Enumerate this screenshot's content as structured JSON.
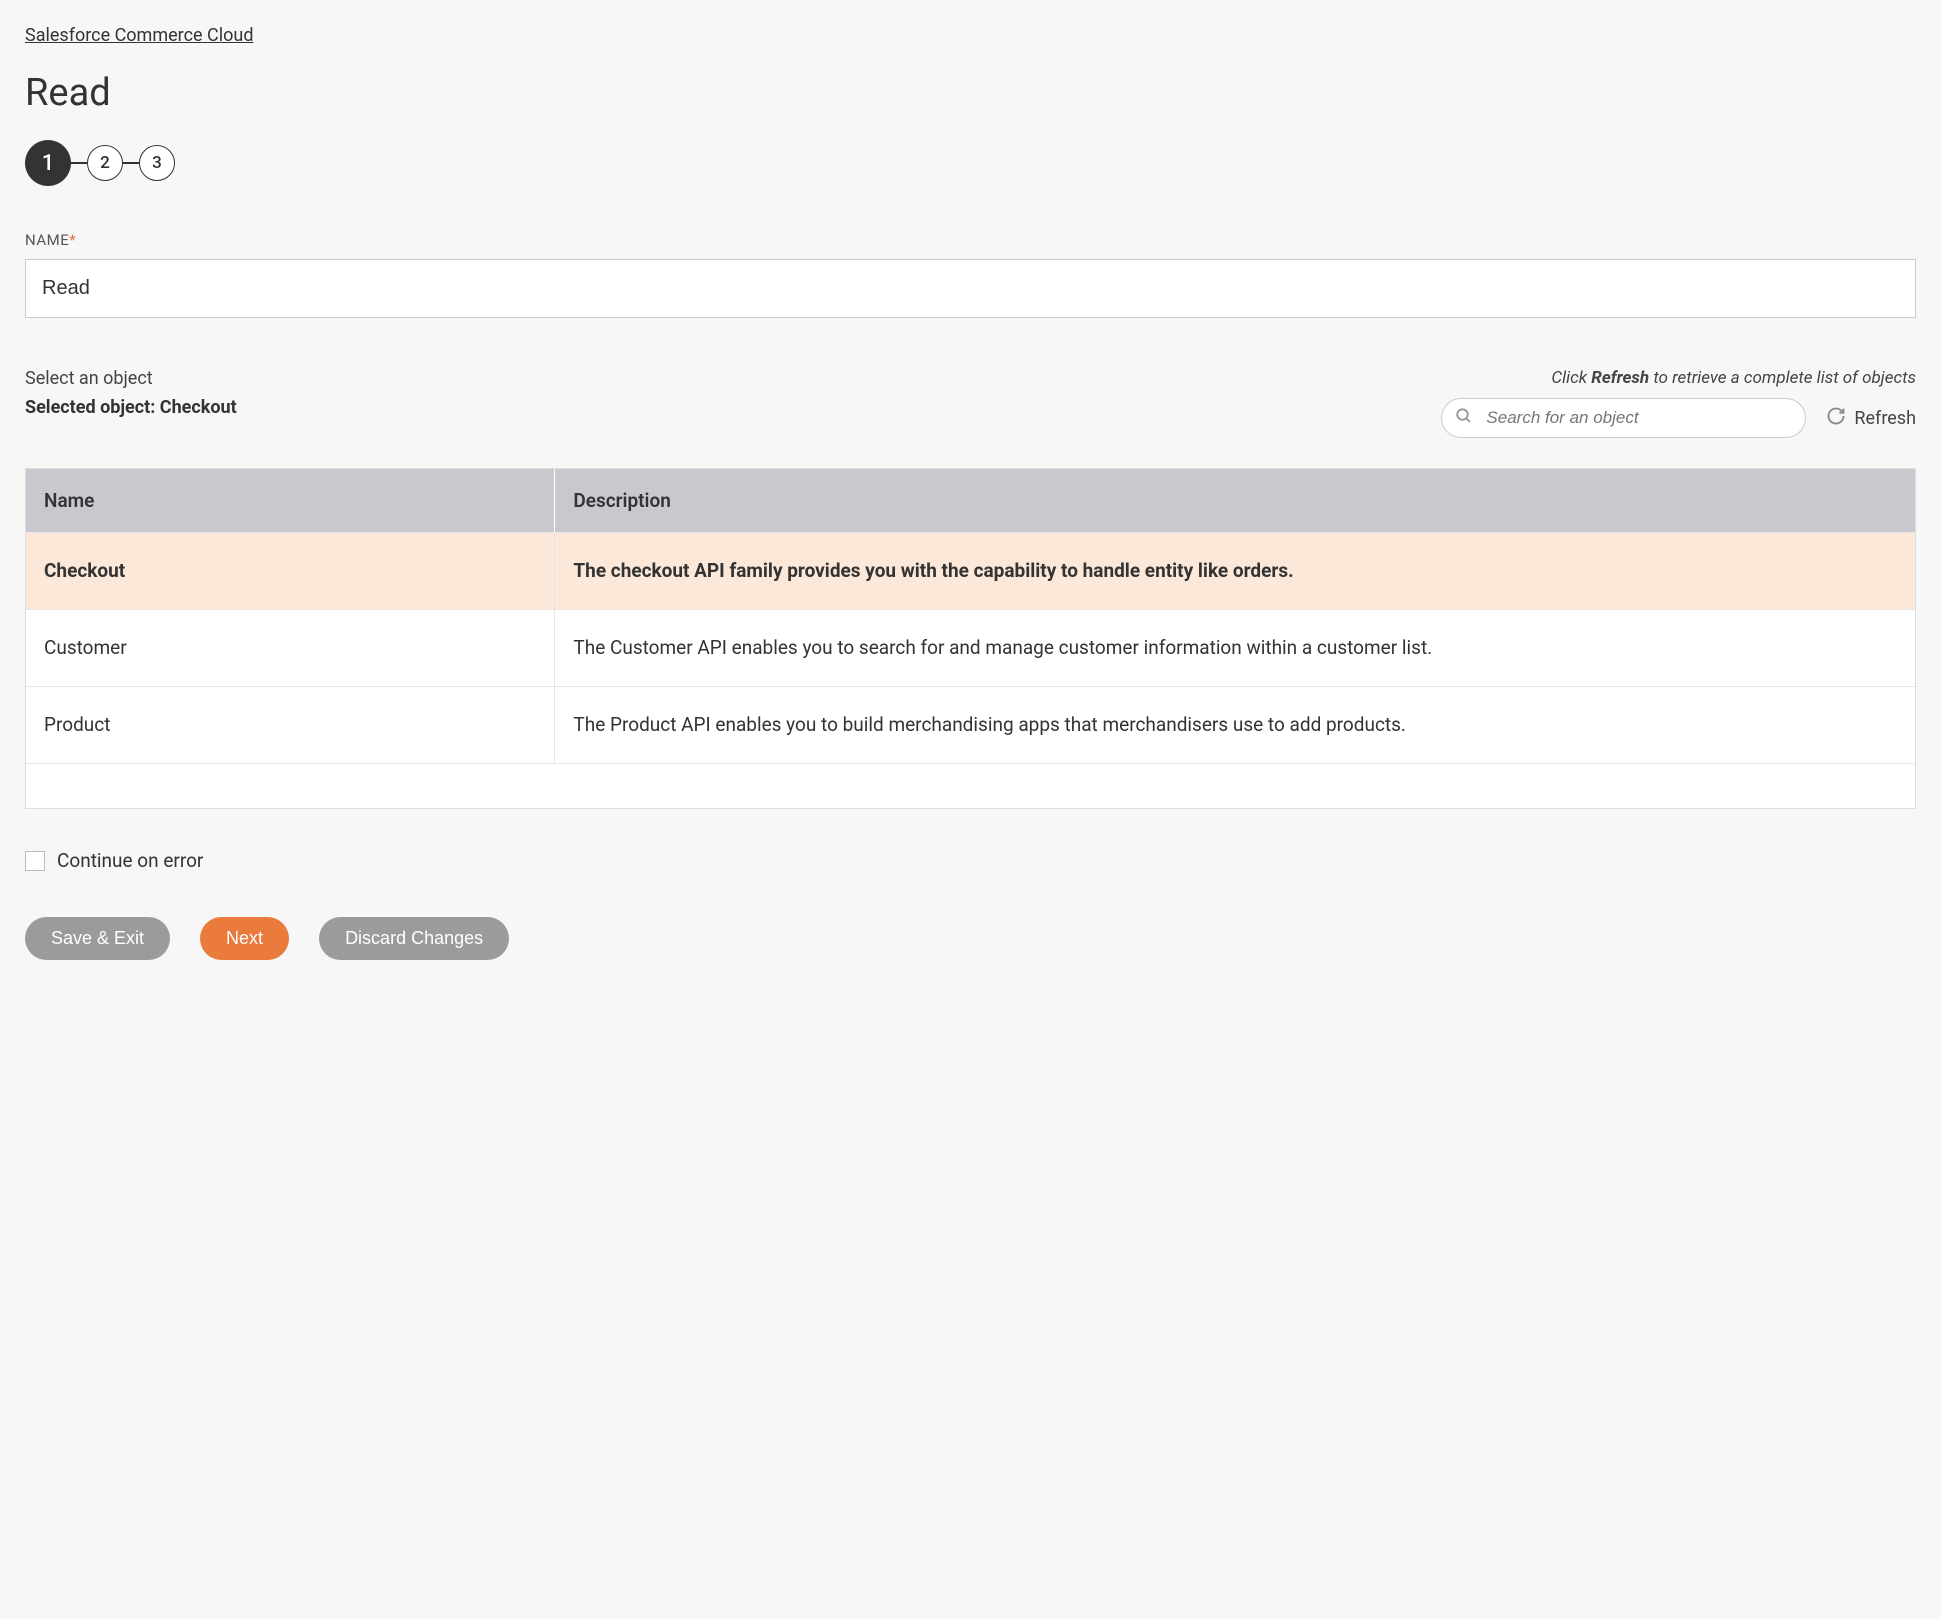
{
  "breadcrumb": "Salesforce Commerce Cloud",
  "page_title": "Read",
  "stepper": {
    "steps": [
      "1",
      "2",
      "3"
    ],
    "active_index": 0
  },
  "name_field": {
    "label": "NAME",
    "required_mark": "*",
    "value": "Read"
  },
  "object_section": {
    "prompt": "Select an object",
    "selected_prefix": "Selected object: ",
    "selected_value": "Checkout",
    "hint_prefix": "Click ",
    "hint_bold": "Refresh",
    "hint_suffix": " to retrieve a complete list of objects",
    "search_placeholder": "Search for an object",
    "refresh_label": "Refresh"
  },
  "table": {
    "headers": {
      "name": "Name",
      "description": "Description"
    },
    "rows": [
      {
        "name": "Checkout",
        "description": "The checkout API family provides you with the capability to handle entity like orders.",
        "selected": true
      },
      {
        "name": "Customer",
        "description": "The Customer API enables you to search for and manage customer information within a customer list.",
        "selected": false
      },
      {
        "name": "Product",
        "description": "The Product API enables you to build merchandising apps that merchandisers use to add products.",
        "selected": false
      }
    ]
  },
  "continue_on_error": {
    "label": "Continue on error",
    "checked": false
  },
  "buttons": {
    "save_exit": "Save & Exit",
    "next": "Next",
    "discard": "Discard Changes"
  }
}
